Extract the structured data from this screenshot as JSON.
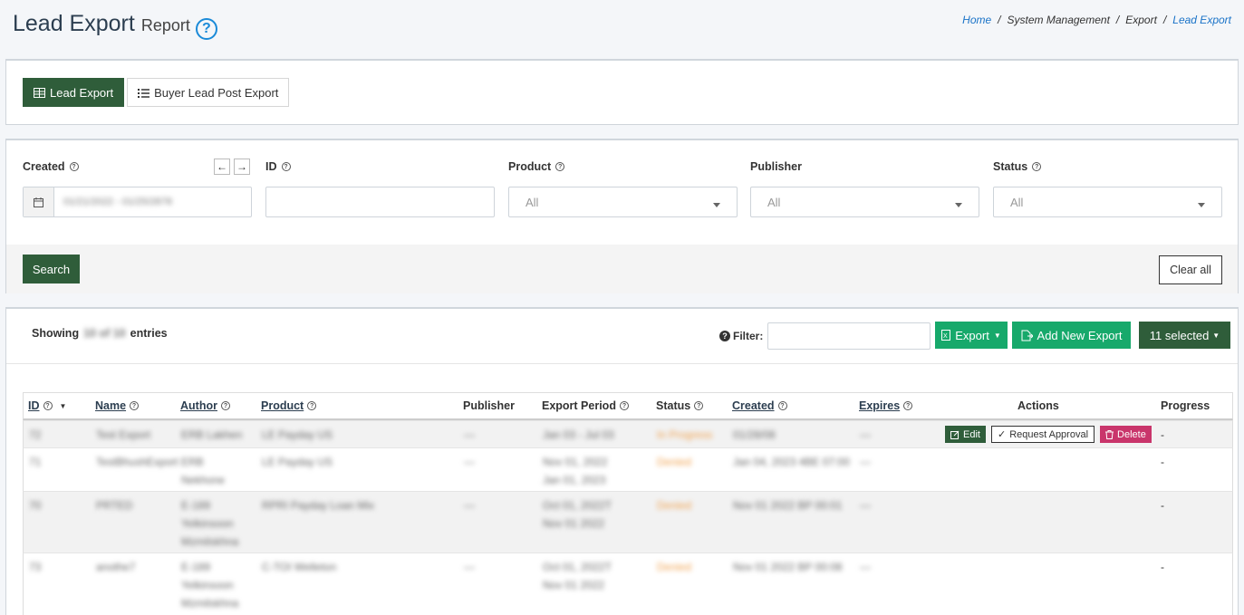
{
  "header": {
    "title": "Lead Export",
    "subtitle": "Report",
    "help": "?",
    "breadcrumb": [
      "Home",
      "System Management",
      "Export",
      "Lead Export"
    ],
    "separator": "/"
  },
  "tabs": [
    {
      "label": "Lead Export",
      "icon": "table-icon",
      "active": true
    },
    {
      "label": "Buyer Lead Post Export",
      "icon": "list-icon",
      "active": false
    }
  ],
  "filters": {
    "created": {
      "label": "Created",
      "value": "01/21/2022 - 01/25/2878"
    },
    "id": {
      "label": "ID",
      "value": ""
    },
    "product": {
      "label": "Product",
      "value": "All"
    },
    "publisher": {
      "label": "Publisher",
      "value": "All"
    },
    "status": {
      "label": "Status",
      "value": "All"
    },
    "search_label": "Search",
    "clear_label": "Clear all"
  },
  "toolbar": {
    "showing_prefix": "Showing",
    "showing_count": "10 of 10",
    "showing_suffix": "entries",
    "filter_label": "Filter:",
    "filter_value": "",
    "export_label": "Export",
    "add_label": "Add New Export",
    "selected_label": "11 selected"
  },
  "table": {
    "columns": [
      "ID",
      "Name",
      "Author",
      "Product",
      "Publisher",
      "Export Period",
      "Status",
      "Created",
      "Expires",
      "Actions",
      "Progress"
    ],
    "rows": [
      {
        "id": "72",
        "name": "Test Export",
        "author": "ERB Lakhen",
        "product": "LE Payday US",
        "publisher": "—",
        "period": "Jan 03 - Jul 03",
        "status": "In Progress",
        "created": "01/28/08",
        "expires": "—",
        "progress": "-"
      },
      {
        "id": "71",
        "name": "TestBhushExport",
        "author": "ERB Nekhone",
        "product": "LE Payday US",
        "publisher": "—",
        "period": "Nov 01, 2022 Jan 01, 2023",
        "status": "Denied",
        "created": "Jan 04, 2023 4BE 07:00",
        "expires": "—",
        "progress": "-"
      },
      {
        "id": "70",
        "name": "PRTED",
        "author": "E-189 Yelkinsoon Mzmilskhna",
        "product": "RPRI Payday Loan Mix",
        "publisher": "—",
        "period": "Oct 01, 2022T Nov 01 2022",
        "status": "Denied",
        "created": "Nov 01 2022 BP 00:01",
        "expires": "—",
        "progress": "-"
      },
      {
        "id": "73",
        "name": "anothe7",
        "author": "E-189 Yelkinsoon Mzmilskhna",
        "product": "C-TOI Welleton",
        "publisher": "—",
        "period": "Oct 01, 2022T Nov 01 2022",
        "status": "Denied",
        "created": "Nov 01 2022 BP 00:08",
        "expires": "—",
        "progress": "-"
      }
    ],
    "actions": {
      "edit": "Edit",
      "request": "Request Approval",
      "delete": "Delete"
    }
  },
  "colors": {
    "primary_green": "#2f5d3a",
    "teal": "#17a96b",
    "delete": "#c9356b",
    "link": "#1a73c8"
  }
}
